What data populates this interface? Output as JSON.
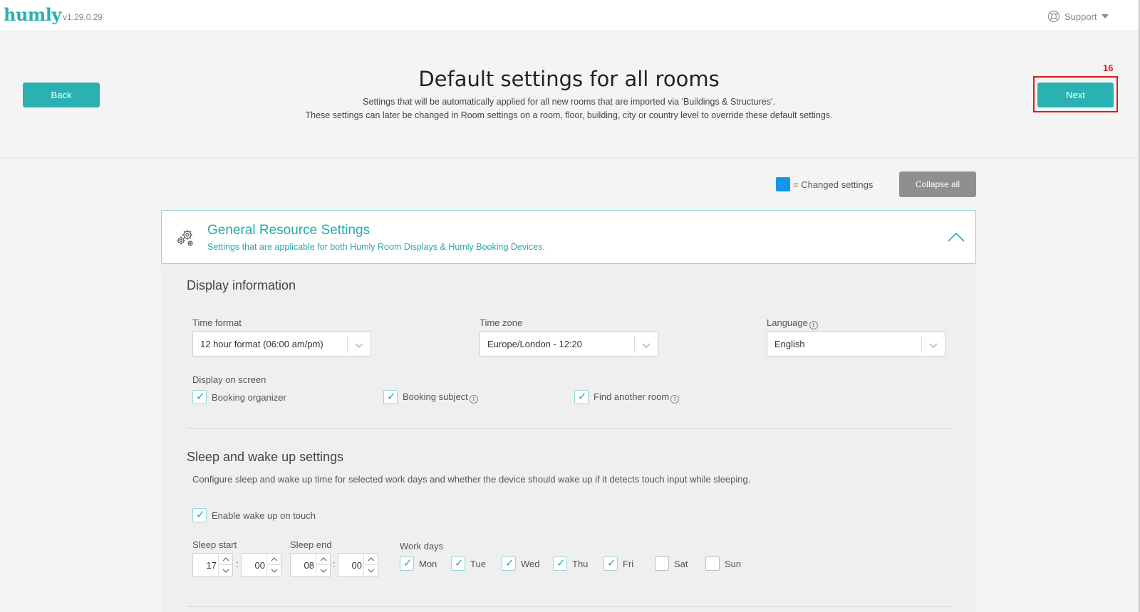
{
  "app": {
    "logo": "humly",
    "version": "v1.29.0.29",
    "support_label": "Support"
  },
  "header": {
    "back_label": "Back",
    "next_label": "Next",
    "annotation_number": "16",
    "title": "Default settings for all rooms",
    "subtitle_1": "Settings that will be automatically applied for all new rooms that are imported via 'Buildings & Structures'.",
    "subtitle_2": "These settings can later be changed in Room settings on a room, floor, building, city or country level to override these default settings."
  },
  "legend": {
    "label": "= Changed settings",
    "swatch_color": "#1496e8",
    "collapse_label": "Collapse all"
  },
  "section": {
    "title": "General Resource Settings",
    "subtitle": "Settings that are applicable for both Humly Room Displays & Humly Booking Devices."
  },
  "display_info": {
    "title": "Display information",
    "time_format": {
      "label": "Time format",
      "value": "12 hour format (06:00 am/pm)"
    },
    "time_zone": {
      "label": "Time zone",
      "value": "Europe/London - 12:20"
    },
    "language": {
      "label": "Language",
      "value": "English",
      "info": "i"
    },
    "display_on_screen": {
      "label": "Display on screen",
      "options": [
        {
          "label": "Booking organizer",
          "checked": true
        },
        {
          "label": "Booking subject",
          "checked": true,
          "info": "i"
        },
        {
          "label": "Find another room",
          "checked": true,
          "info": "i"
        }
      ]
    }
  },
  "sleep": {
    "title": "Sleep and wake up settings",
    "description": "Configure sleep and wake up time for selected work days and whether the device should wake up if it detects touch input while sleeping.",
    "wake_on_touch": {
      "label": "Enable wake up on touch",
      "checked": true
    },
    "sleep_start": {
      "label": "Sleep start",
      "hour": "17",
      "minute": "00"
    },
    "sleep_end": {
      "label": "Sleep end",
      "hour": "08",
      "minute": "00"
    },
    "colon": ":",
    "work_days": {
      "label": "Work days",
      "days": [
        {
          "label": "Mon",
          "checked": true
        },
        {
          "label": "Tue",
          "checked": true
        },
        {
          "label": "Wed",
          "checked": true
        },
        {
          "label": "Thu",
          "checked": true
        },
        {
          "label": "Fri",
          "checked": true
        },
        {
          "label": "Sat",
          "checked": false
        },
        {
          "label": "Sun",
          "checked": false
        }
      ]
    }
  },
  "colors": {
    "accent": "#2ab1b1",
    "highlight": "#e0191e"
  }
}
